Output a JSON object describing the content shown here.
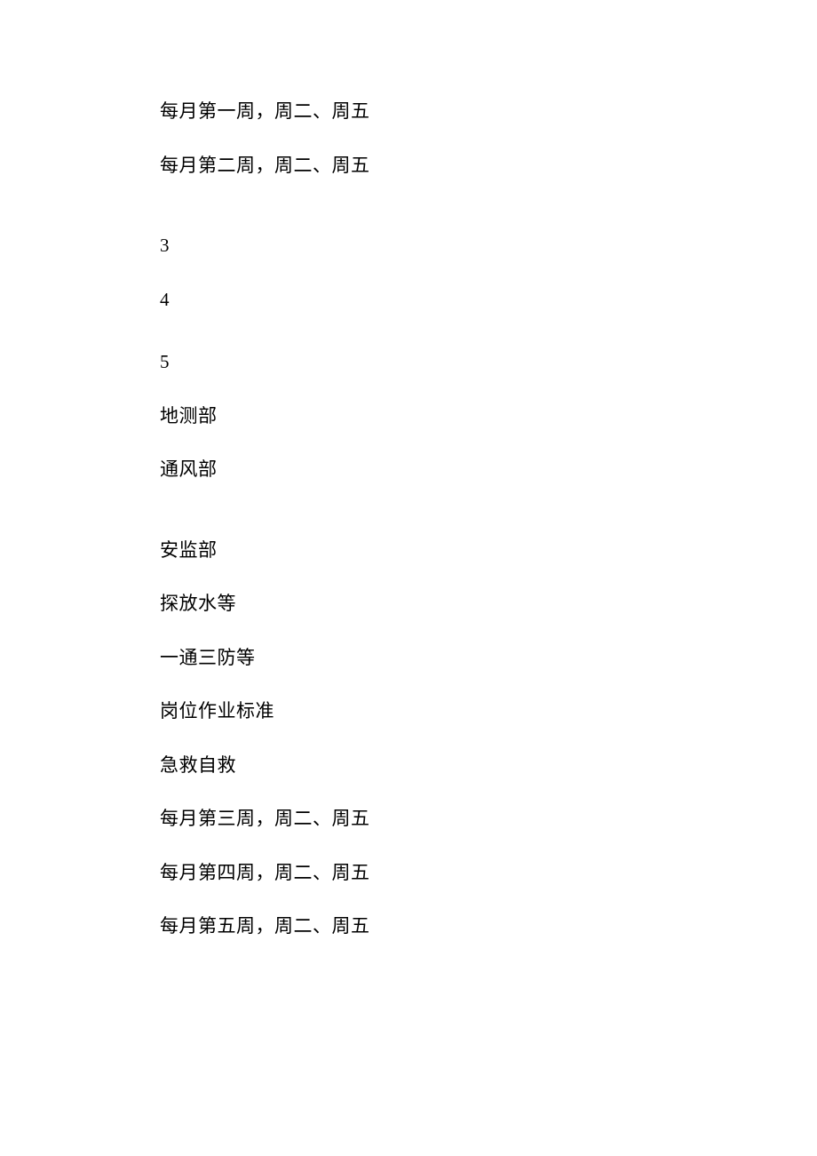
{
  "lines": {
    "l1": "每月第一周，周二、周五",
    "l2": "每月第二周，周二、周五",
    "l3": "3",
    "l4": "4",
    "l5": "5",
    "l6": "地测部",
    "l7": "通风部",
    "l8": "安监部",
    "l9": "探放水等",
    "l10": "一通三防等",
    "l11": "岗位作业标准",
    "l12": "急救自救",
    "l13": "每月第三周，周二、周五",
    "l14": "每月第四周，周二、周五",
    "l15": "每月第五周，周二、周五"
  }
}
